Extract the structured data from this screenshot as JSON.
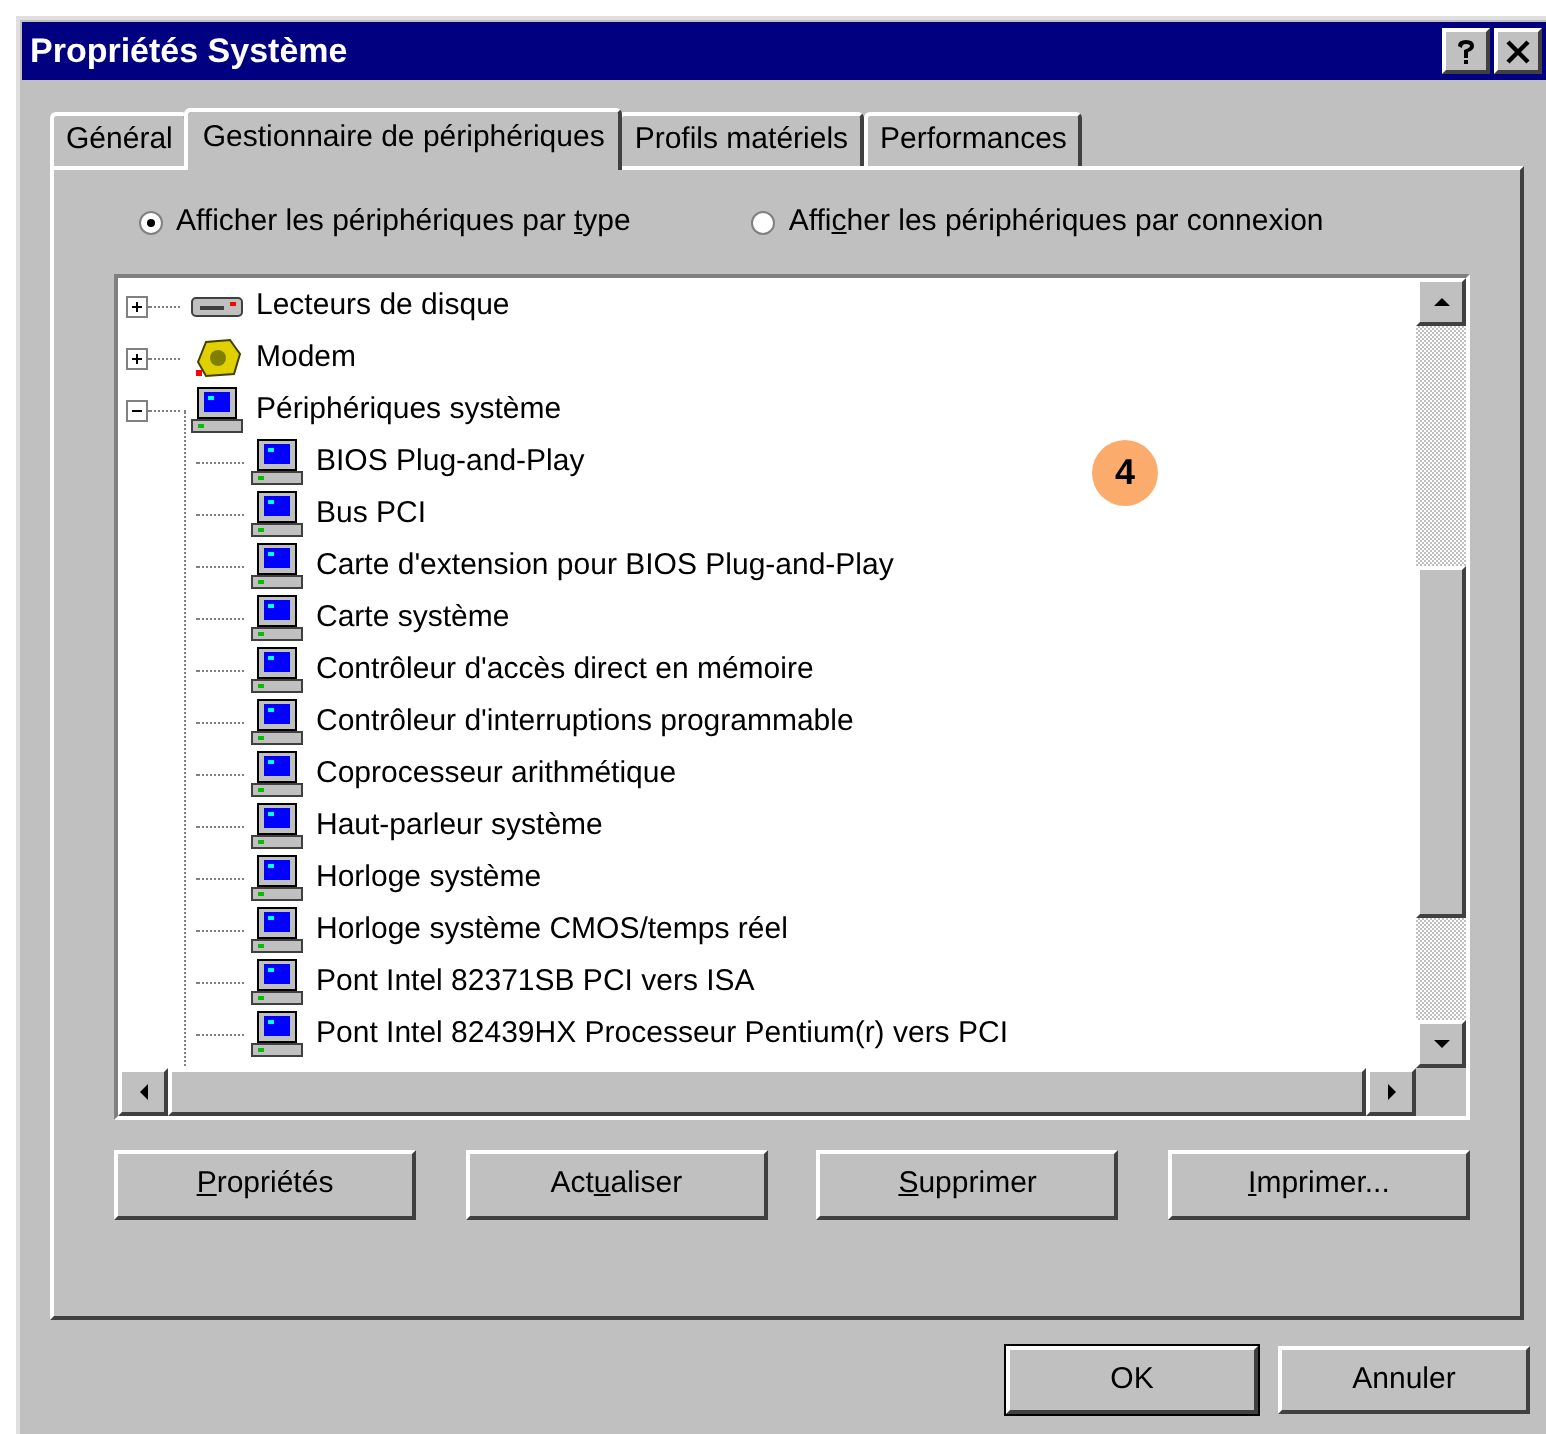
{
  "window": {
    "title": "Propriétés Système"
  },
  "tabs": [
    {
      "label": "Général",
      "selected": false
    },
    {
      "label": "Gestionnaire de périphériques",
      "selected": true
    },
    {
      "label": "Profils matériels",
      "selected": false
    },
    {
      "label": "Performances",
      "selected": false
    }
  ],
  "view_options": [
    {
      "label_parts": [
        "Afficher les périphériques par ",
        "t",
        "ype"
      ],
      "selected": true
    },
    {
      "label_parts": [
        "Affi",
        "c",
        "her les périphériques par connexion"
      ],
      "selected": false
    }
  ],
  "tree": {
    "items": [
      {
        "label": "Lecteurs de disque",
        "kind": "disk",
        "expanded": false
      },
      {
        "label": "Modem",
        "kind": "modem",
        "expanded": false
      },
      {
        "label": "Périphériques système",
        "kind": "computer",
        "expanded": true,
        "children": [
          {
            "label": "BIOS Plug-and-Play",
            "kind": "computer"
          },
          {
            "label": "Bus PCI",
            "kind": "computer"
          },
          {
            "label": "Carte d'extension pour BIOS Plug-and-Play",
            "kind": "computer"
          },
          {
            "label": "Carte système",
            "kind": "computer"
          },
          {
            "label": "Contrôleur d'accès direct en mémoire",
            "kind": "computer"
          },
          {
            "label": "Contrôleur d'interruptions programmable",
            "kind": "computer"
          },
          {
            "label": "Coprocesseur arithmétique",
            "kind": "computer"
          },
          {
            "label": "Haut-parleur système",
            "kind": "computer"
          },
          {
            "label": "Horloge système",
            "kind": "computer"
          },
          {
            "label": "Horloge système CMOS/temps réel",
            "kind": "computer"
          },
          {
            "label": "Pont Intel 82371SB PCI vers ISA",
            "kind": "computer"
          },
          {
            "label": "Pont Intel 82439HX Processeur Pentium(r) vers PCI",
            "kind": "computer"
          }
        ]
      }
    ]
  },
  "callout": {
    "label": "4"
  },
  "actions": [
    {
      "access_key": "P",
      "label_rest": "ropriétés"
    },
    {
      "label_start": "Act",
      "access_key": "u",
      "label_rest": "aliser"
    },
    {
      "access_key": "S",
      "label_rest": "upprimer"
    },
    {
      "access_key": "I",
      "label_rest": "mprimer..."
    }
  ],
  "dialog_buttons": [
    {
      "label": "OK",
      "default": true
    },
    {
      "label": "Annuler",
      "default": false
    }
  ]
}
